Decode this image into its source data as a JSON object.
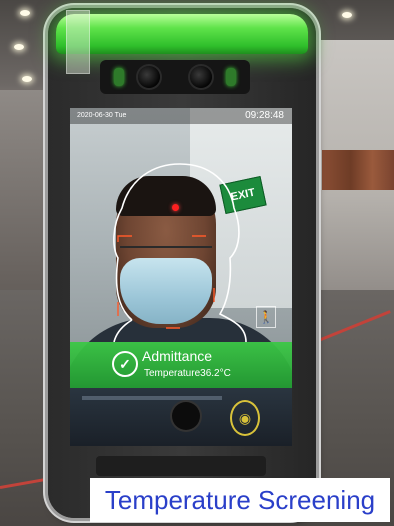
{
  "screen": {
    "date": "2020-06-30 Tue",
    "time": "09:28:48",
    "exit_sign": "EXIT",
    "result": {
      "title": "Admittance",
      "temperature": "Temperature36.2°C",
      "status_color": "#3cc846"
    },
    "icons": [
      "check-icon",
      "walking-person-icon",
      "card-reader-icon"
    ]
  },
  "device": {
    "indicator_color": "#5fe34a"
  },
  "caption": {
    "text": "Temperature Screening",
    "color": "#2a3fc9"
  }
}
